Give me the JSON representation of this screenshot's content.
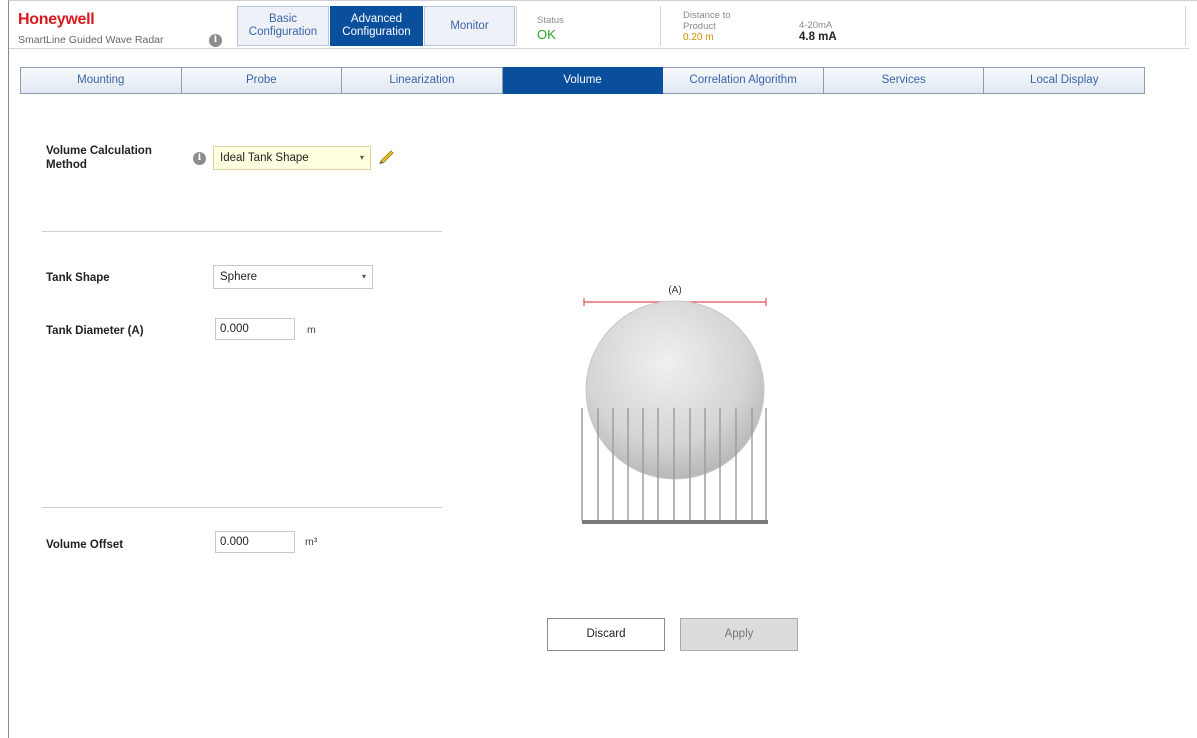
{
  "header": {
    "brand": "Honeywell",
    "product": "SmartLine Guided Wave Radar",
    "info_glyph": "i",
    "nav_tabs": [
      {
        "line1": "Basic",
        "line2": "Configuration"
      },
      {
        "line1": "Advanced",
        "line2": "Configuration"
      },
      {
        "label": "Monitor"
      }
    ],
    "active_nav": "Advanced Configuration",
    "status": {
      "label": "Status",
      "value": "OK"
    },
    "distance": {
      "label1": "Distance to",
      "label2": "Product",
      "value": "0.20 m"
    },
    "current": {
      "label": "4-20mA",
      "value": "4.8 mA"
    },
    "colors": {
      "brand": "#d71920",
      "ok": "#29a329",
      "distance": "#d48c00",
      "accent": "#0a4f9c"
    }
  },
  "subtabs": [
    "Mounting",
    "Probe",
    "Linearization",
    "Volume",
    "Correlation Algorithm",
    "Services",
    "Local Display"
  ],
  "active_subtab": "Volume",
  "form": {
    "volume_method": {
      "label_line1": "Volume Calculation",
      "label_line2": "Method",
      "value": "Ideal Tank Shape",
      "info_glyph": "i"
    },
    "tank_shape": {
      "label": "Tank Shape",
      "value": "Sphere"
    },
    "tank_diameter": {
      "label": "Tank Diameter (A)",
      "value": "0.000",
      "unit": "m"
    },
    "volume_offset": {
      "label": "Volume Offset",
      "value": "0.000",
      "unit": "m³"
    },
    "dropdown_caret": "▾"
  },
  "diagram": {
    "dimension_label": "(A)",
    "shape": "sphere"
  },
  "buttons": {
    "discard": "Discard",
    "apply": "Apply"
  },
  "icons": [
    "info-icon",
    "dropdown-caret-icon",
    "pencil-icon",
    "sphere-tank-diagram"
  ]
}
